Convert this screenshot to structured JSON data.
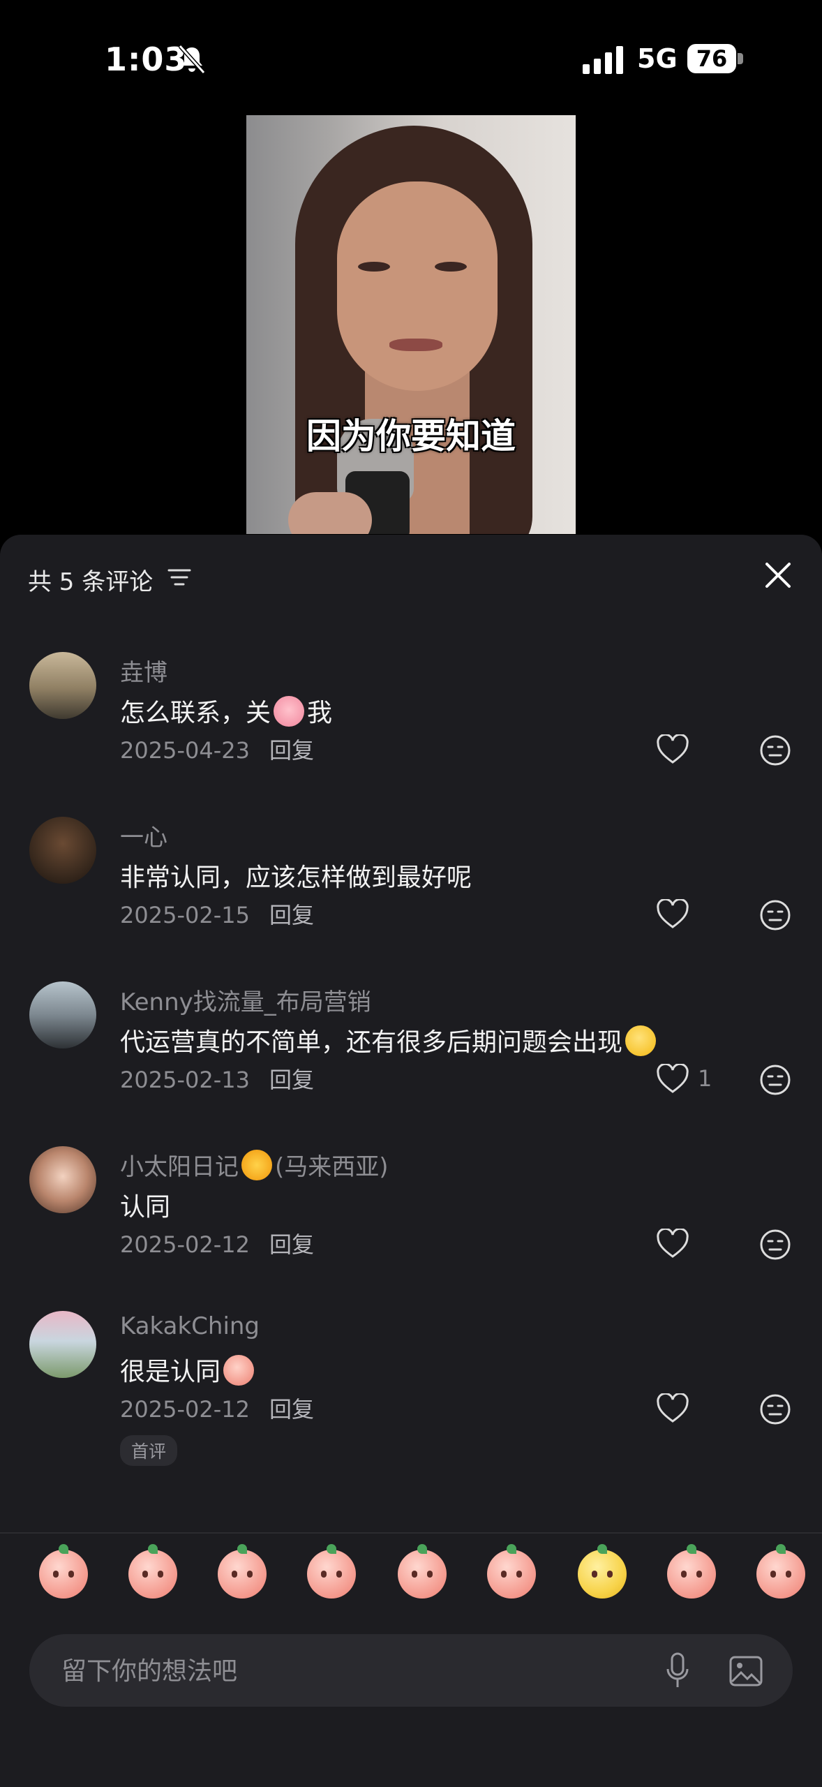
{
  "status_bar": {
    "time": "1:03",
    "network": "5G",
    "battery": "76"
  },
  "video": {
    "caption": "因为你要知道"
  },
  "comments_panel": {
    "title": "共 5 条评论",
    "comments": [
      {
        "user": "垚博",
        "text_parts": [
          "怎么联系，关",
          "我"
        ],
        "inline_emoji": "pig-face",
        "date": "2025-04-23",
        "reply": "回复",
        "likes": ""
      },
      {
        "user": "一心",
        "text": "非常认同，应该怎样做到最好呢",
        "date": "2025-02-15",
        "reply": "回复",
        "likes": ""
      },
      {
        "user": "Kenny找流量_布局营销",
        "text": "代运营真的不简单，还有很多后期问题会出现",
        "inline_emoji": "face-with-hand-over-mouth",
        "date": "2025-02-13",
        "reply": "回复",
        "likes": "1"
      },
      {
        "user": "小太阳日记",
        "user_suffix": "(马来西亚)",
        "inline_emoji": "sun",
        "text": "认同",
        "date": "2025-02-12",
        "reply": "回复",
        "likes": ""
      },
      {
        "user": "KakakChing",
        "text": "很是认同",
        "inline_emoji": "peach-sticker",
        "date": "2025-02-12",
        "reply": "回复",
        "likes": "",
        "badge": "首评"
      }
    ]
  },
  "emoji_bar": [
    "kiss",
    "crying-tears",
    "cover-mouth",
    "laugh-cry",
    "smile",
    "thinking",
    "surprised-dog",
    "sob",
    "angry"
  ],
  "input": {
    "placeholder": "留下你的想法吧"
  },
  "colors": {
    "sheet_bg": "#1c1c20",
    "secondary_text": "#8e8e93",
    "input_bg": "#2a2a2f"
  }
}
